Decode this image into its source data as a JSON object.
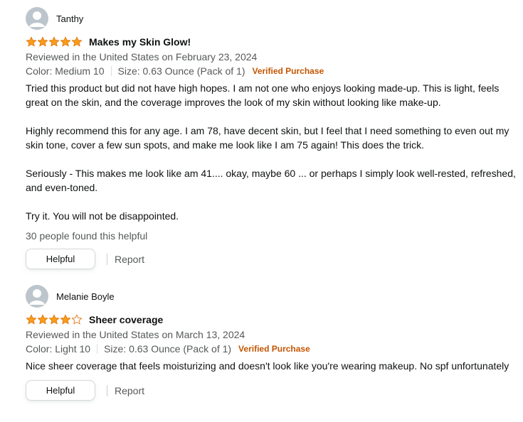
{
  "reviews": [
    {
      "reviewer": "Tanthy",
      "rating": 5,
      "title": "Makes my Skin Glow!",
      "reviewed_in": "Reviewed in the United States on February 23, 2024",
      "color": "Color: Medium 10",
      "size": "Size: 0.63 Ounce (Pack of 1)",
      "verified": "Verified Purchase",
      "body": [
        "Tried this product but did not have high hopes. I am not one who enjoys looking made-up. This is light, feels great on the skin, and the coverage improves the look of my skin without looking like make-up.",
        "Highly recommend this for any age. I am 78, have decent skin, but I feel that I need something to even out my skin tone, cover a few sun spots, and make me look like I am 75 again! This does the trick.",
        "Seriously - This makes me look like am 41.... okay, maybe 60 ... or perhaps I simply look well-rested, refreshed, and even-toned.",
        "Try it. You will not be disappointed."
      ],
      "helpful_count": "30 people found this helpful",
      "helpful_label": "Helpful",
      "report_label": "Report"
    },
    {
      "reviewer": "Melanie Boyle",
      "rating": 4,
      "title": "Sheer coverage",
      "reviewed_in": "Reviewed in the United States on March 13, 2024",
      "color": "Color: Light 10",
      "size": "Size: 0.63 Ounce (Pack of 1)",
      "verified": "Verified Purchase",
      "body": [
        "Nice sheer coverage that feels moisturizing and doesn't look like you're wearing makeup. No spf unfortunately"
      ],
      "helpful_label": "Helpful",
      "report_label": "Report"
    }
  ],
  "colors": {
    "star": "#f79c1b",
    "verified": "#c45500",
    "muted_text": "#565959"
  },
  "icons": {
    "avatar": "default-user-avatar-icon",
    "star_full": "star-filled-icon",
    "star_empty": "star-outline-icon"
  }
}
